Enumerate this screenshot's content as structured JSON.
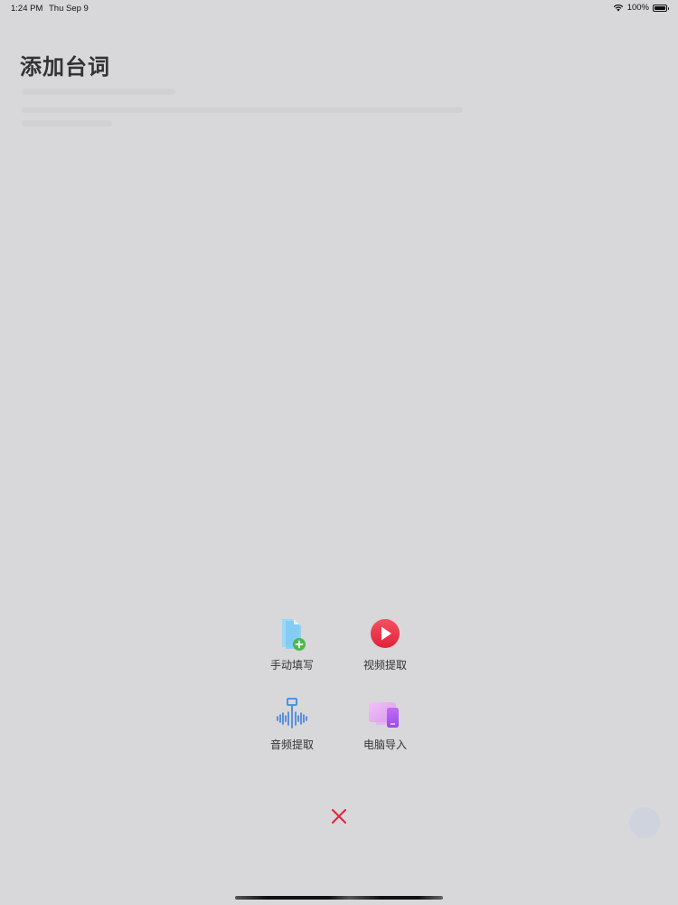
{
  "status_bar": {
    "time": "1:24 PM",
    "date": "Thu Sep 9",
    "battery": "100%"
  },
  "page": {
    "title": "添加台词"
  },
  "menu": {
    "items": [
      {
        "label": "手动填写",
        "icon": "add-document-icon"
      },
      {
        "label": "视频提取",
        "icon": "play-icon"
      },
      {
        "label": "音频提取",
        "icon": "audio-wave-icon"
      },
      {
        "label": "电脑导入",
        "icon": "computer-import-icon"
      }
    ]
  },
  "colors": {
    "overlay_background": "#d8d7d9",
    "close_red": "#e0223b",
    "play_red": "#f0384a",
    "doc_blue": "#8fd0f5",
    "plus_green": "#4cb84c",
    "wave_blue": "#3a7ee0",
    "computer_purple": "#b061f0"
  }
}
